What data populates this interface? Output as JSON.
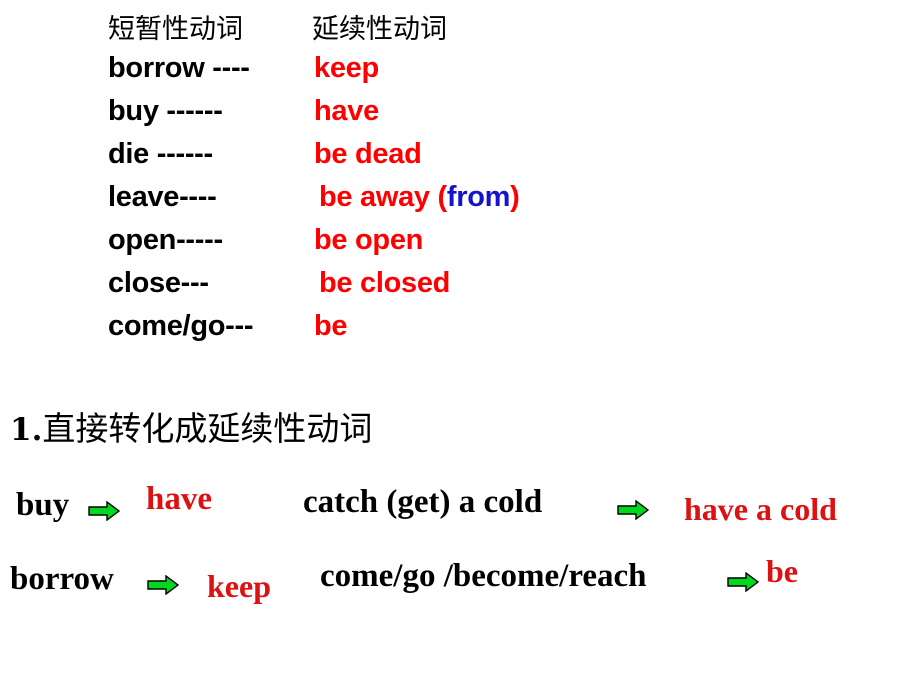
{
  "slide": {
    "background_color": "#FFFFFF",
    "colors": {
      "black": "#000000",
      "red": "#FF0000",
      "serif_red": "#DD1111",
      "blue": "#1414CC",
      "arrow_green": "#00D820",
      "arrow_outline": "#000000"
    }
  },
  "verb_table": {
    "headers": {
      "left": "短暂性动词",
      "right": "延续性动词"
    },
    "rows": [
      {
        "left": "borrow ----",
        "right": "keep",
        "right_suffix": "",
        "blue_word": ""
      },
      {
        "left": "buy  ------",
        "right": "have",
        "right_suffix": "",
        "blue_word": ""
      },
      {
        "left": "die   ------",
        "right": "be dead",
        "right_suffix": "",
        "blue_word": ""
      },
      {
        "left": "leave----",
        "right": "be away ",
        "right_suffix": "",
        "blue_word": "from"
      },
      {
        "left": "open-----",
        "right": "be open",
        "right_suffix": "",
        "blue_word": ""
      },
      {
        "left": "close---",
        "right": "be closed",
        "right_suffix": "",
        "blue_word": ""
      },
      {
        "left": "come/go---",
        "right": "be",
        "right_suffix": "",
        "blue_word": ""
      }
    ],
    "paren_open": "(",
    "paren_close": ")"
  },
  "section": {
    "number": "1.",
    "title": "直接转化成延续性动词"
  },
  "examples": [
    {
      "source": "buy",
      "target": "have"
    },
    {
      "source": "catch (get) a cold",
      "target": "have a cold"
    },
    {
      "source": "borrow",
      "target": "keep"
    },
    {
      "source": "come/go /become/reach",
      "target": "be"
    }
  ]
}
